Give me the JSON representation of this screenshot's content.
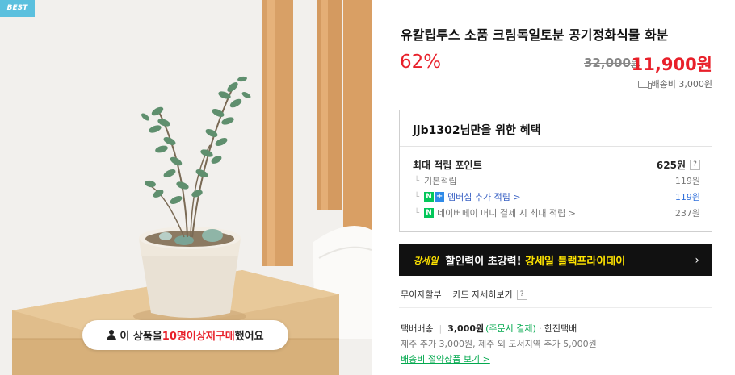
{
  "badge": "BEST",
  "rebuy": {
    "prefix": "이 상품을 ",
    "count": "10명",
    "mid": " 이상 ",
    "highlight": "재구매",
    "suffix": " 했어요"
  },
  "product": {
    "title": "유칼립투스 소품 크림독일토분 공기정화식물 화분",
    "discount": "62%",
    "original_price": "32,000",
    "original_unit": "원",
    "sale_price": "11,900원",
    "shipping_fee": "배송비 3,000원"
  },
  "benefit": {
    "header": "jjb1302님만을 위한 혜택",
    "max_point_label": "최대 적립 포인트",
    "max_point_value": "625원",
    "qmark": "?",
    "rows": [
      {
        "label": "기본적립",
        "value": "119원"
      },
      {
        "label": "멤버십 추가 적립 >",
        "value": "119원"
      },
      {
        "label": "네이버페이 머니 결제 시 최대 적립 >",
        "value": "237원"
      }
    ],
    "npay_icon": "N",
    "nplus_icon": "+"
  },
  "promo": {
    "tag": "강세일",
    "text_white": "할인력이 초강력! ",
    "text_yellow": "강세일 블랙프라이데이",
    "arrow": "›"
  },
  "card": {
    "installment": "무이자할부",
    "detail": "카드 자세히보기",
    "qmark": "?"
  },
  "delivery": {
    "type": "택배배송",
    "price": "3,000원",
    "note": "(주문시 결제)",
    "carrier": "· 한진택배",
    "extra": "제주 추가 3,000원, 제주 외 도서지역 추가 5,000원",
    "bundle_link": "배송비 절약상품 보기 >"
  },
  "colors": {
    "accent_red": "#e8202a",
    "npay_green": "#03c75a",
    "promo_yellow": "#ffe400",
    "link_blue": "#3a62c4"
  }
}
